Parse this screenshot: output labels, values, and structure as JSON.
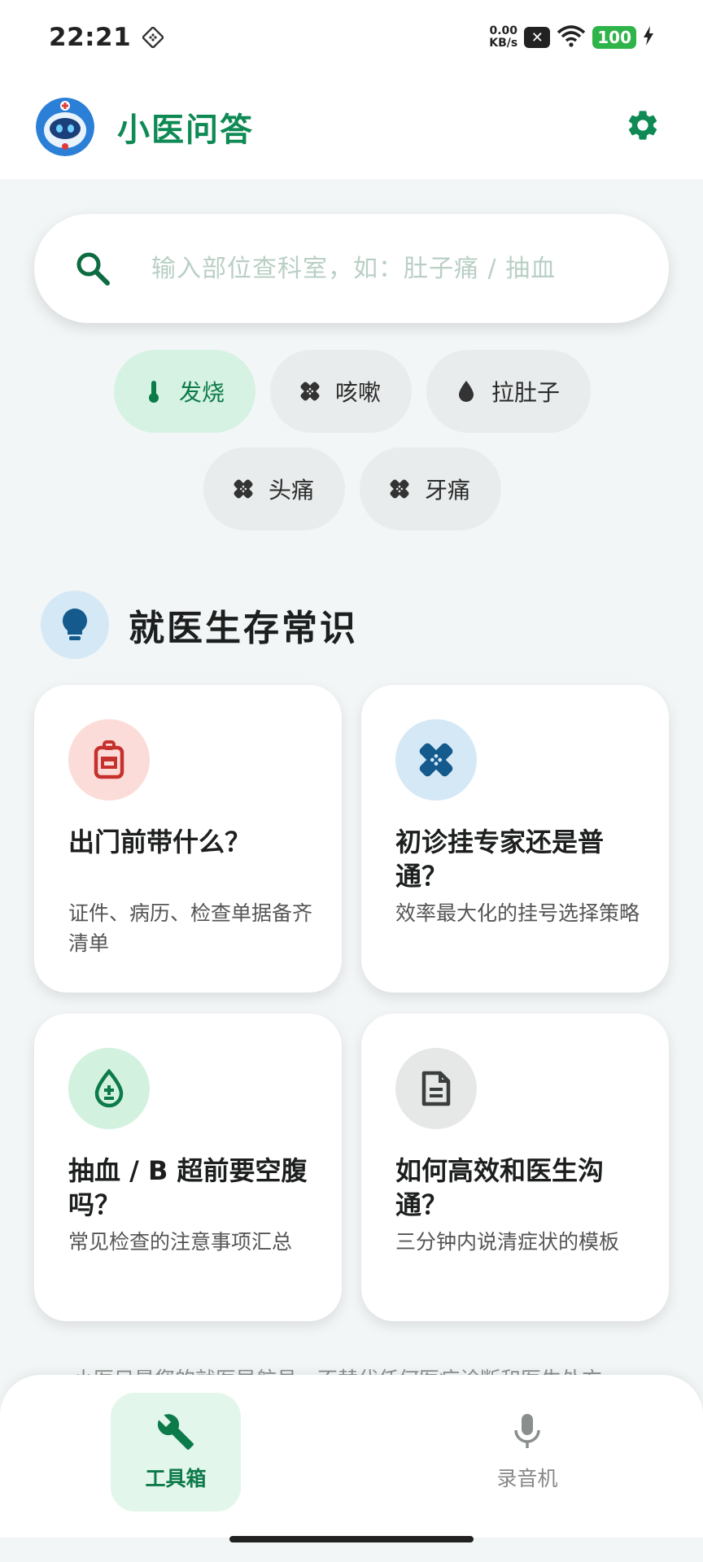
{
  "status_bar": {
    "time": "22:21",
    "net_speed_value": "0.00",
    "net_speed_unit": "KB/s",
    "battery": "100"
  },
  "app_bar": {
    "title": "小医问答"
  },
  "search": {
    "placeholder": "输入部位查科室，如：肚子痛 / 抽血"
  },
  "chips": [
    {
      "label": "发烧",
      "icon": "thermometer-icon",
      "active": true
    },
    {
      "label": "咳嗽",
      "icon": "bandage-icon",
      "active": false
    },
    {
      "label": "拉肚子",
      "icon": "water-drop-icon",
      "active": false
    },
    {
      "label": "头痛",
      "icon": "bandage-icon",
      "active": false
    },
    {
      "label": "牙痛",
      "icon": "bandage-icon",
      "active": false
    }
  ],
  "section": {
    "title": "就医生存常识",
    "icon": "lightbulb-icon"
  },
  "cards": [
    {
      "title": "出门前带什么？",
      "desc": "证件、病历、检查单据备齐清单",
      "icon": "backpack-icon",
      "icon_bg": "#fcdcd8",
      "icon_color": "#c6312d"
    },
    {
      "title": "初诊挂专家还是普通？",
      "desc": "效率最大化的挂号选择策略",
      "icon": "bandage-icon",
      "icon_bg": "#d5e8f6",
      "icon_color": "#145a8d"
    },
    {
      "title": "抽血 / B 超前要空腹吗？",
      "desc": "常见检查的注意事项汇总",
      "icon": "blood-drop-icon",
      "icon_bg": "#d3f1df",
      "icon_color": "#0d7a49"
    },
    {
      "title": "如何高效和医生沟通？",
      "desc": "三分钟内说清症状的模板",
      "icon": "document-icon",
      "icon_bg": "#e6e8e7",
      "icon_color": "#3a3f3d"
    }
  ],
  "footer": {
    "text": "小医只是您的就医导航员，不替代任何医疗诊断和医生处方"
  },
  "bottom_nav": {
    "items": [
      {
        "label": "工具箱",
        "icon": "wrench-icon",
        "active": true
      },
      {
        "label": "录音机",
        "icon": "microphone-icon",
        "active": false
      }
    ]
  },
  "colors": {
    "brand": "#0f8a55",
    "chip_active_bg": "#d6f2e2",
    "chip_bg": "#e9ecec",
    "background": "#f3f6f7"
  }
}
